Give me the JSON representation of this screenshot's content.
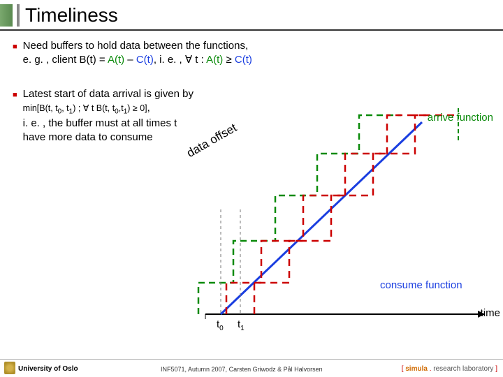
{
  "title": "Timeliness",
  "bullets": {
    "b1_a": "Need buffers to hold data between the functions,",
    "b1_b_pre": "e. g. , client B(t) = ",
    "b1_b_A": "A(t)",
    "b1_b_mid1": " – ",
    "b1_b_C": "C(t)",
    "b1_b_mid2": ", i. e. , ∀ t : ",
    "b1_b_A2": "A(t)",
    "b1_b_ge": " ≥ ",
    "b1_b_C2": "C(t)",
    "b2_a": "Latest start of data arrival is given by",
    "b2_min_pre": "min[B(t, t",
    "b2_min_mid": ", t",
    "b2_min_post": ") ; ∀ t B(t, t",
    "b2_min_post2": ") ≥ 0]",
    "b2_c": ",",
    "b2_d": "i. e. , the buffer must at all times t have more data to consume"
  },
  "labels": {
    "arrive": "arrive function",
    "consume": "consume function",
    "time": "time",
    "t0": "t",
    "t0s": "0",
    "t1": "t",
    "t1s": "1",
    "offset": "data offset"
  },
  "footer": {
    "uni": "University of Oslo",
    "mid": "INF5071, Autumn 2007, Carsten Griwodz & Pål Halvorsen",
    "lab_open": "[ ",
    "lab_sim": "simula",
    "lab_dot": " . ",
    "lab_rest": "research laboratory ",
    "lab_close": "]"
  }
}
